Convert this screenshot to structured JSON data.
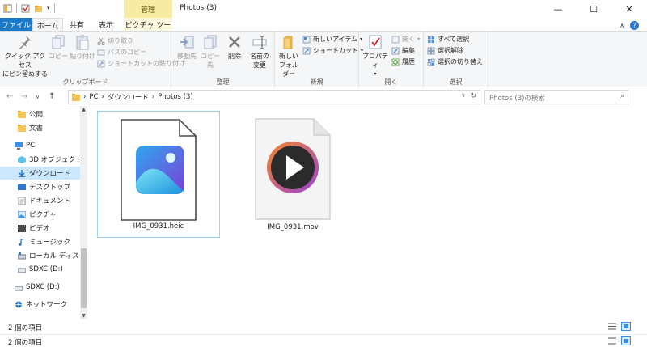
{
  "window": {
    "title": "Photos (3)",
    "minimize": "—",
    "maximize": "☐",
    "close": "✕",
    "help": "?",
    "collapse_ribbon": "∧",
    "manage_tab": "管理"
  },
  "tabs": {
    "file": "ファイル",
    "home": "ホーム",
    "share": "共有",
    "view": "表示",
    "picture_tools": "ピクチャ ツール"
  },
  "ribbon": {
    "clipboard": {
      "label": "クリップボード",
      "pin_line1": "クイック アクセス",
      "pin_line2": "にピン留めする",
      "copy": "コピー",
      "paste": "貼り付け",
      "cut": "切り取り",
      "copy_path": "パスのコピー",
      "paste_shortcut": "ショートカットの貼り付け"
    },
    "organize": {
      "label": "整理",
      "move_to": "移動先",
      "copy_to": "コピー先",
      "delete": "削除",
      "rename_line1": "名前の",
      "rename_line2": "変更"
    },
    "new": {
      "label": "新規",
      "new_folder_line1": "新しい",
      "new_folder_line2": "フォルダー",
      "new_item": "新しいアイテム",
      "shortcut": "ショートカット"
    },
    "open": {
      "label": "開く",
      "properties": "プロパティ",
      "open": "開く",
      "edit": "編集",
      "history": "履歴"
    },
    "select": {
      "label": "選択",
      "select_all": "すべて選択",
      "select_none": "選択解除",
      "invert": "選択の切り替え"
    }
  },
  "address": {
    "back": "←",
    "forward": "→",
    "recent": "∨",
    "up": "↑",
    "path": [
      "PC",
      "ダウンロード",
      "Photos (3)"
    ],
    "separator": "›",
    "dropdown": "∨",
    "refresh": "↻",
    "search_placeholder": "Photos (3)の検索",
    "search_icon": "⌕"
  },
  "nav": {
    "items": [
      {
        "label": "公開",
        "icon": "folder-icon"
      },
      {
        "label": "文書",
        "icon": "folder-icon"
      },
      {
        "label": "PC",
        "icon": "pc-icon"
      },
      {
        "label": "3D オブジェクト",
        "icon": "3d-objects-icon"
      },
      {
        "label": "ダウンロード",
        "icon": "download-icon"
      },
      {
        "label": "デスクトップ",
        "icon": "desktop-icon"
      },
      {
        "label": "ドキュメント",
        "icon": "documents-icon"
      },
      {
        "label": "ピクチャ",
        "icon": "pictures-icon"
      },
      {
        "label": "ビデオ",
        "icon": "videos-icon"
      },
      {
        "label": "ミュージック",
        "icon": "music-icon"
      },
      {
        "label": "ローカル ディスク (C",
        "icon": "drive-icon"
      },
      {
        "label": "SDXC (D:)",
        "icon": "drive-icon"
      },
      {
        "label": "SDXC (D:)",
        "icon": "drive-icon"
      },
      {
        "label": "ネットワーク",
        "icon": "network-icon"
      }
    ]
  },
  "files": [
    {
      "name": "IMG_0931.heic",
      "icon": "photos-app-icon"
    },
    {
      "name": "IMG_0931.mov",
      "icon": "media-player-icon"
    }
  ],
  "status": {
    "count": "2 個の項目",
    "count_bottom": "2 個の項目"
  },
  "colors": {
    "accent": "#1979ca",
    "selection": "#cce8ff",
    "manage_tab": "#f7eba3",
    "ribbon_bg": "#f5f6f7"
  }
}
